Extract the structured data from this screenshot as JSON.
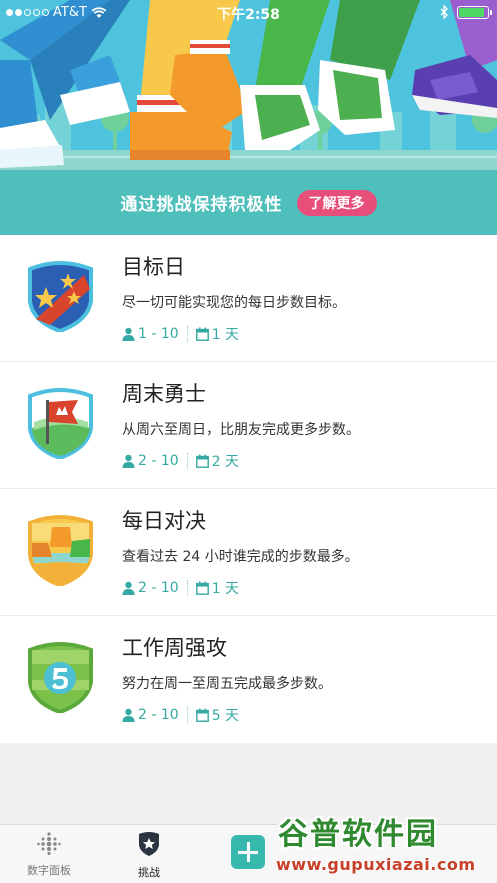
{
  "status_bar": {
    "carrier": "AT&T",
    "time": "下午2:58",
    "signal_bars_filled": 2,
    "signal_bars_total": 5,
    "battery_level": 0.9,
    "icons": [
      "wifi-icon",
      "bluetooth-icon",
      "battery-icon"
    ]
  },
  "banner": {
    "title": "通过挑战保持积极性",
    "learn_more": "了解更多"
  },
  "challenges": [
    {
      "title": "目标日",
      "description": "尽一切可能实现您的每日步数目标。",
      "participants": "1 - 10",
      "duration": "1 天",
      "badge": "stars-badge"
    },
    {
      "title": "周末勇士",
      "description": "从周六至周日，比朋友完成更多步数。",
      "participants": "2 - 10",
      "duration": "2 天",
      "badge": "flag-badge"
    },
    {
      "title": "每日对决",
      "description": "查看过去 24 小时谁完成的步数最多。",
      "participants": "2 - 10",
      "duration": "1 天",
      "badge": "shoes-badge"
    },
    {
      "title": "工作周强攻",
      "description": "努力在周一至周五完成最多步数。",
      "participants": "2 - 10",
      "duration": "5 天",
      "badge": "five-badge"
    }
  ],
  "tab_bar": {
    "dashboard": "数字面板",
    "challenges": "挑战",
    "active_tab": "challenges"
  },
  "watermark": {
    "title": "谷普软件园",
    "url": "www.gupuxiazai.com"
  },
  "colors": {
    "teal": "#4fbfbb",
    "accent_pink": "#e84e7a",
    "meta_teal": "#35a9a3",
    "sky": "#4ec3dd"
  }
}
